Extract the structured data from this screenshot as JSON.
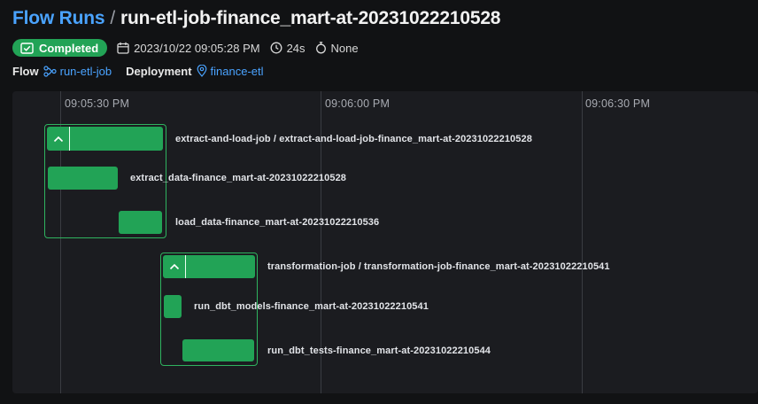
{
  "breadcrumb": {
    "parent": "Flow Runs",
    "separator": "/",
    "current": "run-etl-job-finance_mart-at-20231022210528"
  },
  "meta": {
    "status": "Completed",
    "start_time": "2023/10/22 09:05:28 PM",
    "duration": "24s",
    "tags": "None"
  },
  "links": {
    "flow_label": "Flow",
    "flow_name": "run-etl-job",
    "deployment_label": "Deployment",
    "deployment_name": "finance-etl"
  },
  "timeline": {
    "ticks": [
      "09:05:30 PM",
      "09:06:00 PM",
      "09:06:30 PM"
    ],
    "runs": [
      "extract-and-load-job / extract-and-load-job-finance_mart-at-20231022210528",
      "extract_data-finance_mart-at-20231022210528",
      "load_data-finance_mart-at-20231022210536",
      "transformation-job / transformation-job-finance_mart-at-20231022210541",
      "run_dbt_models-finance_mart-at-20231022210541",
      "run_dbt_tests-finance_mart-at-20231022210544"
    ]
  },
  "colors": {
    "accent": "#4aa3ff",
    "success": "#22a356",
    "background": "#111214",
    "panel": "#1b1c20"
  }
}
